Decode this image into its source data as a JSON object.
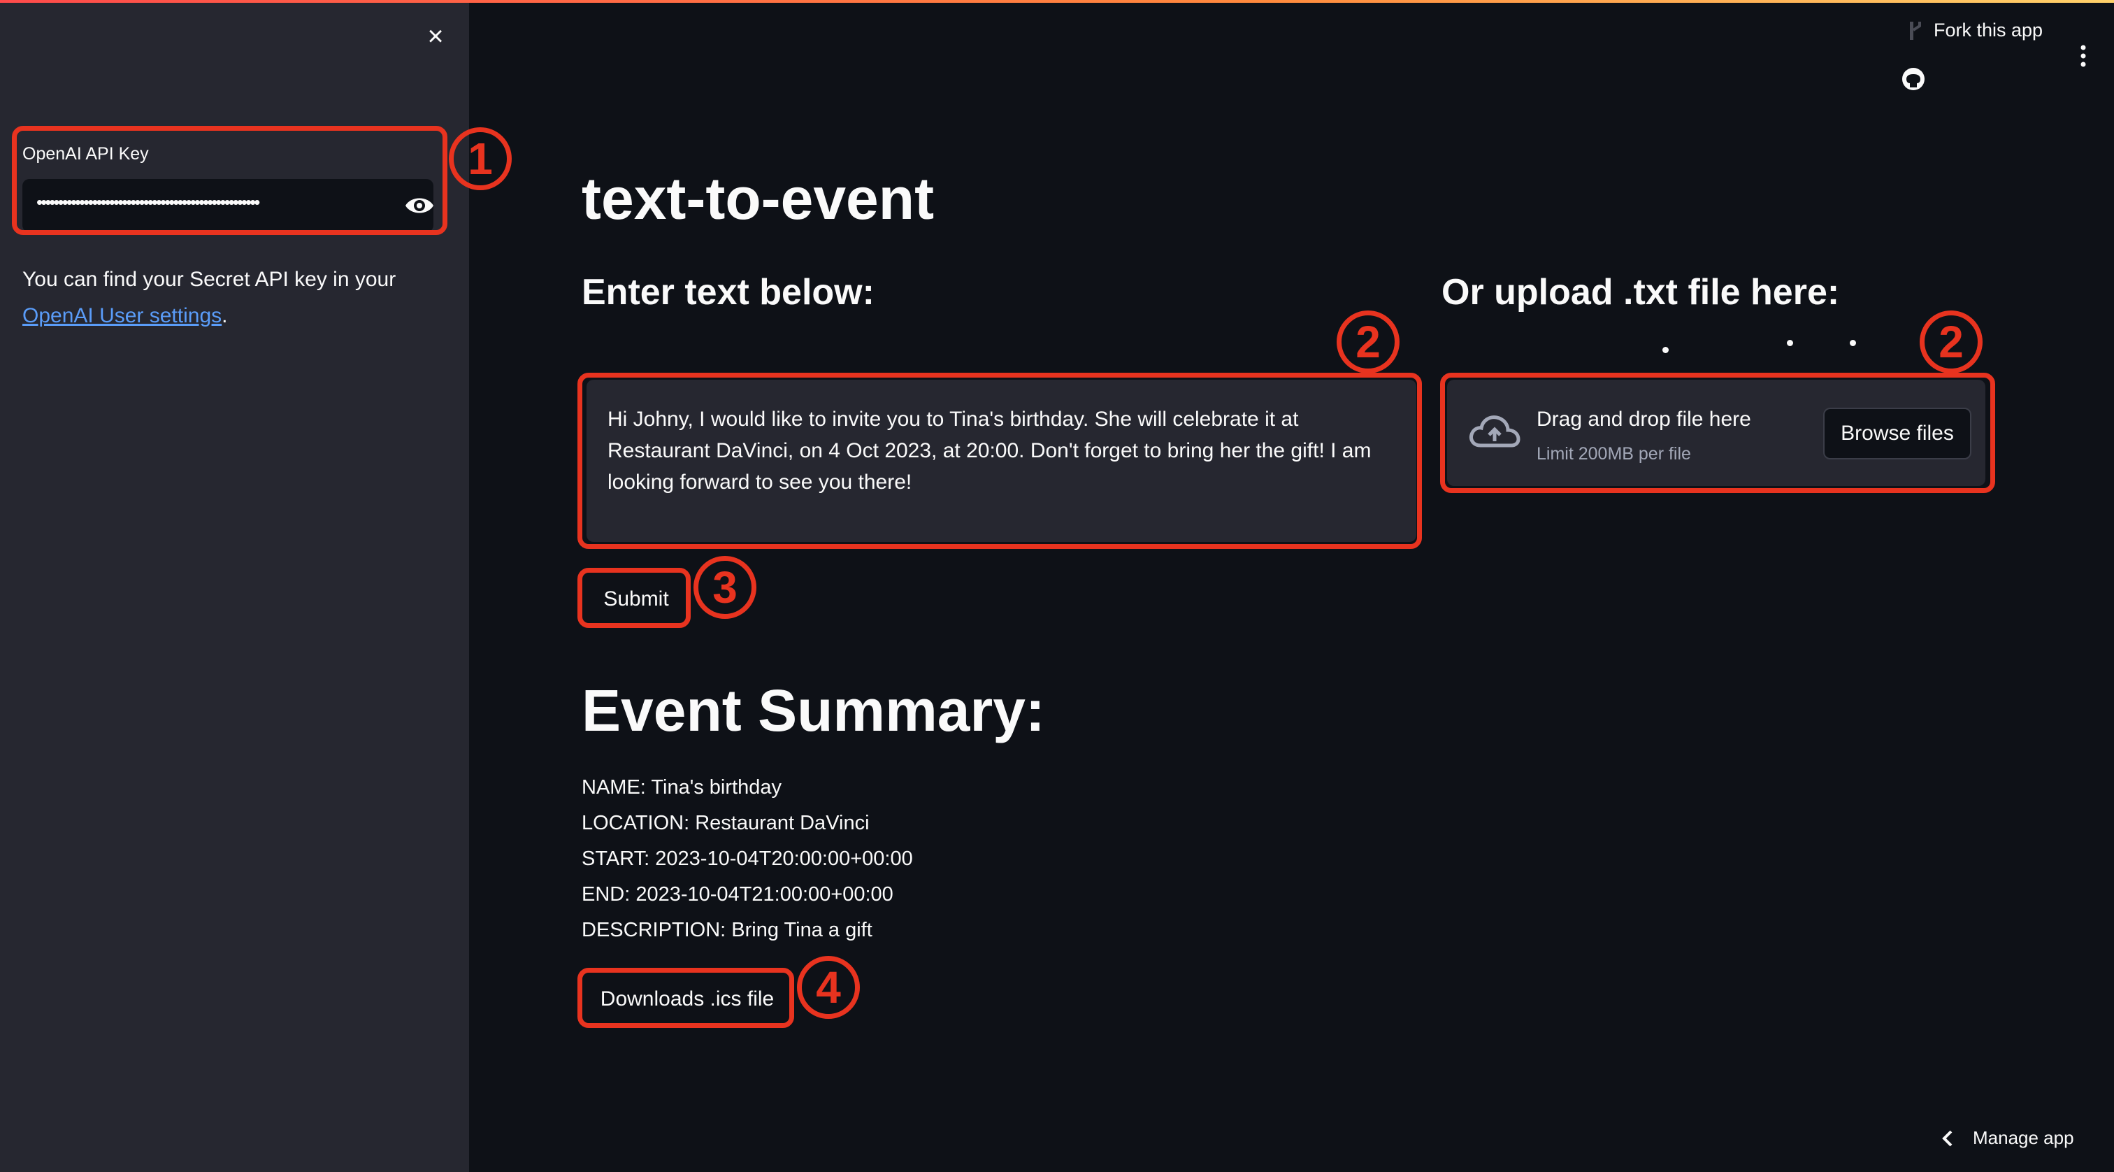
{
  "sidebar": {
    "close_glyph": "×",
    "api_key_label": "OpenAI API Key",
    "api_key_value": "••••••••••••••••••••••••••••••••••••••••••••••••••••",
    "help_text": "You can find your Secret API key in your",
    "help_link": "OpenAI User settings",
    "help_suffix": "."
  },
  "header": {
    "fork_label": "Fork this app",
    "icons": [
      "fork-icon",
      "github-icon",
      "more-vert-icon"
    ]
  },
  "main": {
    "title": "text-to-event",
    "text_heading": "Enter text below:",
    "upload_heading": "Or upload .txt file here:",
    "textarea_value": "Hi Johny, I would like to invite you to Tina's birthday. She will celebrate it at Restaurant DaVinci, on 4 Oct 2023, at 20:00. Don't forget to bring her the gift! I am looking forward to see you there!",
    "uploader": {
      "drop_text": "Drag and drop file here",
      "limit_text": "Limit 200MB per file",
      "browse_label": "Browse files",
      "icon": "cloud-upload-icon"
    },
    "submit_label": "Submit",
    "summary_heading": "Event Summary:",
    "summary_lines": [
      "NAME: Tina's birthday",
      "LOCATION: Restaurant DaVinci",
      "START: 2023-10-04T20:00:00+00:00",
      "END: 2023-10-04T21:00:00+00:00",
      "DESCRIPTION: Bring Tina a gift"
    ],
    "download_label": "Downloads .ics file"
  },
  "footer": {
    "manage_label": "Manage app"
  },
  "annotations": [
    "1",
    "2",
    "2",
    "3",
    "4"
  ],
  "colors": {
    "annotation": "#e8331f",
    "sidebar_bg": "#262730",
    "main_bg": "#0e1117",
    "link": "#5a9cf8"
  }
}
